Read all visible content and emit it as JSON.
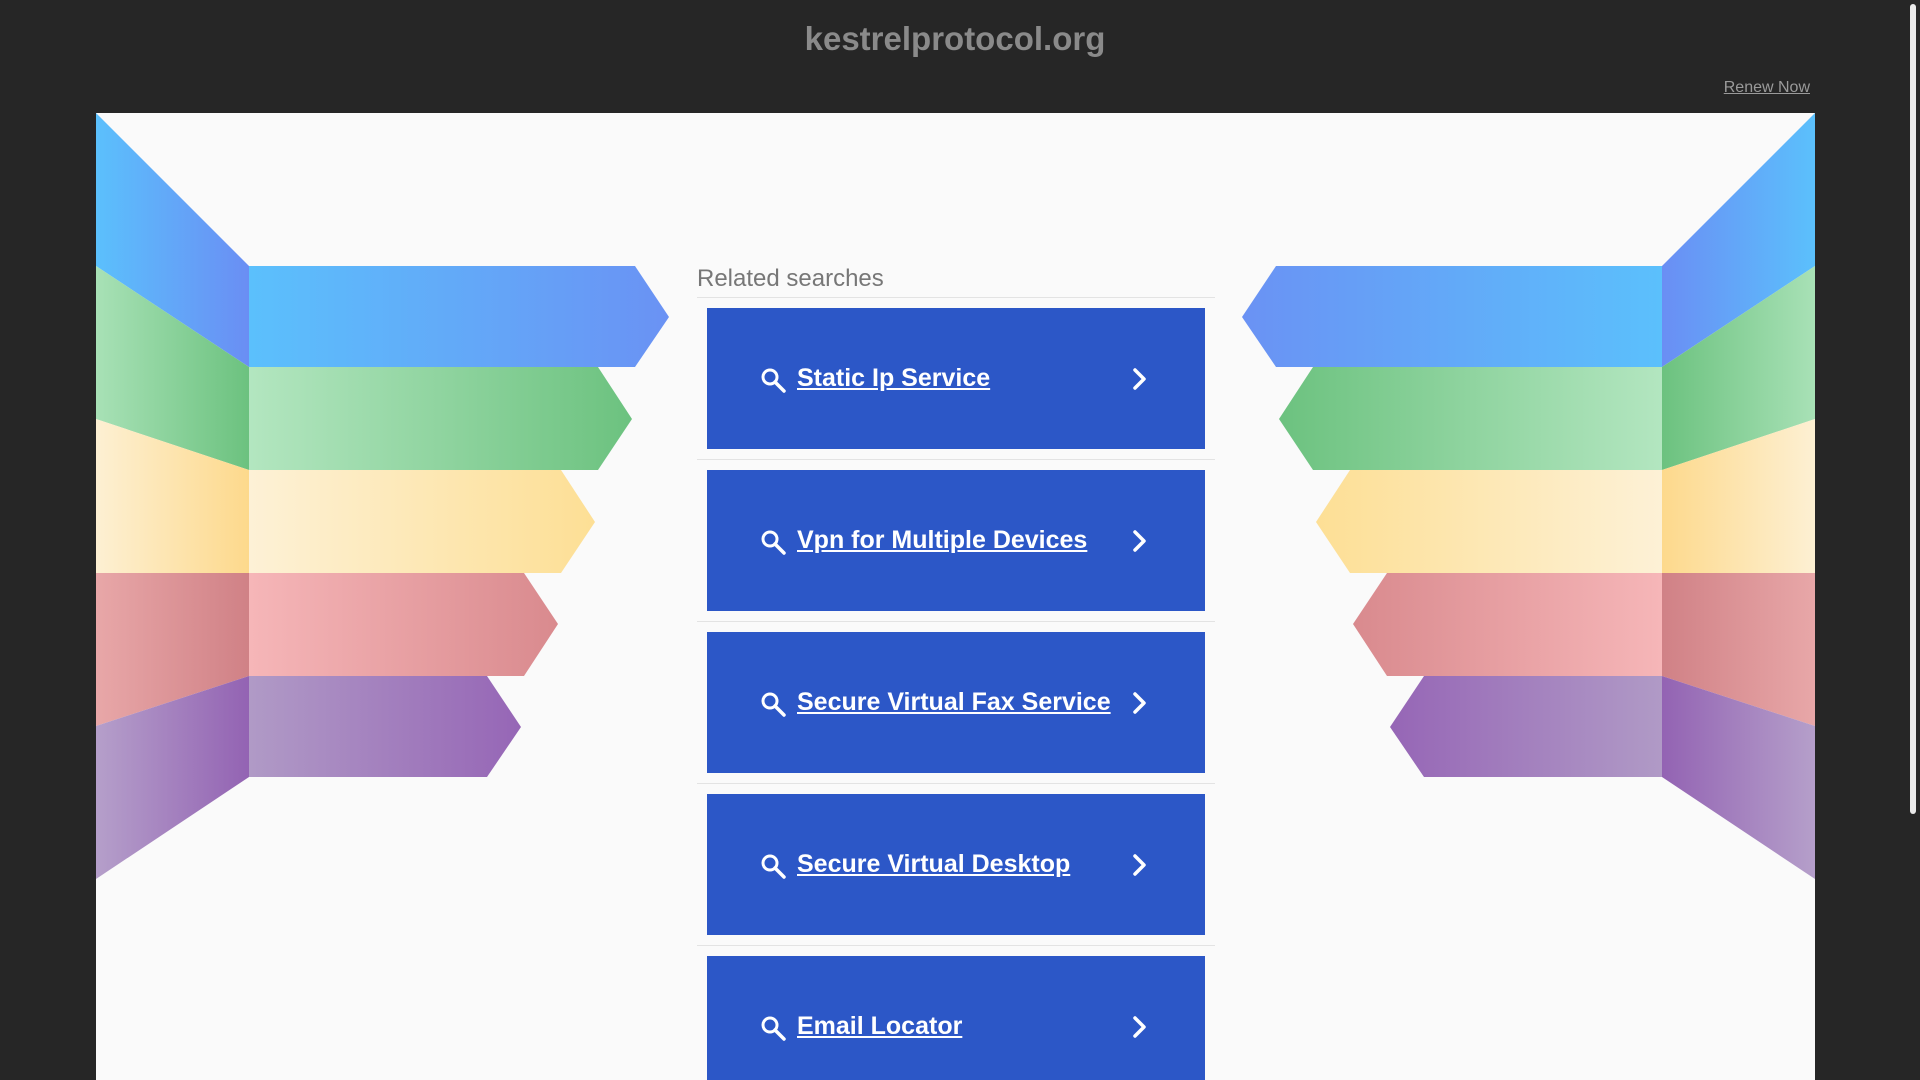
{
  "header": {
    "domain": "kestrelprotocol.org",
    "renew_label": "Renew Now"
  },
  "related": {
    "title": "Related searches",
    "items": [
      {
        "label": "Static Ip Service"
      },
      {
        "label": "Vpn for Multiple Devices"
      },
      {
        "label": "Secure Virtual Fax Service"
      },
      {
        "label": "Secure Virtual Desktop"
      },
      {
        "label": "Email Locator"
      }
    ]
  },
  "icons": {
    "search": "search-icon",
    "chevron": "chevron-right-icon"
  },
  "colors": {
    "background": "#262626",
    "panel": "#fafafa",
    "button": "#2c57c7",
    "domain_text": "#8a8a8a",
    "blue": "#5fb6fb",
    "green": "#7ec98d",
    "yellow": "#fde3a2",
    "red": "#e7a1a4",
    "purple": "#a98bc2"
  }
}
